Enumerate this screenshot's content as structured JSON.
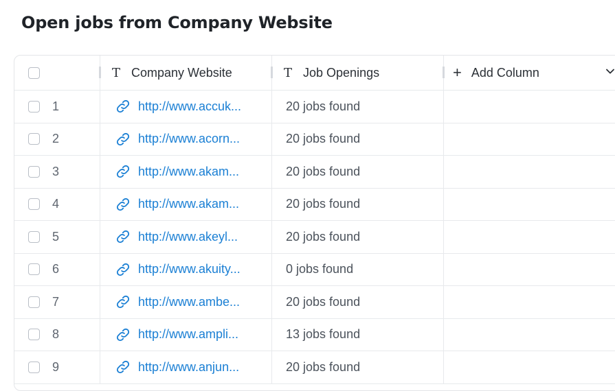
{
  "page_title": "Open jobs from Company Website",
  "columns": {
    "website": "Company Website",
    "openings": "Job Openings",
    "add": "Add Column"
  },
  "icons": {
    "text_type": "text-type-icon",
    "link": "link-icon",
    "plus": "plus-icon",
    "chevron": "chevron-down-icon"
  },
  "colors": {
    "link": "#1a7fd4",
    "border": "#e3e5e8"
  },
  "rows": [
    {
      "num": "1",
      "url": "http://www.accuk...",
      "jobs": "20 jobs found"
    },
    {
      "num": "2",
      "url": "http://www.acorn...",
      "jobs": "20 jobs found"
    },
    {
      "num": "3",
      "url": "http://www.akam...",
      "jobs": "20 jobs found"
    },
    {
      "num": "4",
      "url": "http://www.akam...",
      "jobs": "20 jobs found"
    },
    {
      "num": "5",
      "url": "http://www.akeyl...",
      "jobs": "20 jobs found"
    },
    {
      "num": "6",
      "url": "http://www.akuity...",
      "jobs": "0 jobs found"
    },
    {
      "num": "7",
      "url": "http://www.ambe...",
      "jobs": "20 jobs found"
    },
    {
      "num": "8",
      "url": "http://www.ampli...",
      "jobs": "13 jobs found"
    },
    {
      "num": "9",
      "url": "http://www.anjun...",
      "jobs": "20 jobs found"
    }
  ]
}
